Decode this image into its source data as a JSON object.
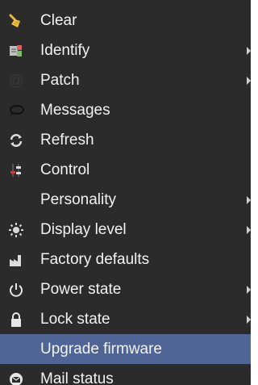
{
  "menu": {
    "items": [
      {
        "label": "Clear",
        "icon": "broom-icon",
        "has_submenu": false
      },
      {
        "label": "Identify",
        "icon": "identify-icon",
        "has_submenu": true
      },
      {
        "label": "Patch",
        "icon": "at-sign-icon",
        "has_submenu": true
      },
      {
        "label": "Messages",
        "icon": "speech-bubble-icon",
        "has_submenu": false
      },
      {
        "label": "Refresh",
        "icon": "refresh-icon",
        "has_submenu": false
      },
      {
        "label": "Control",
        "icon": "control-sliders-icon",
        "has_submenu": false
      },
      {
        "label": "Personality",
        "icon": "smiley-icon",
        "has_submenu": true
      },
      {
        "label": "Display level",
        "icon": "brightness-icon",
        "has_submenu": true
      },
      {
        "label": "Factory defaults",
        "icon": "factory-icon",
        "has_submenu": false
      },
      {
        "label": "Power state",
        "icon": "power-icon",
        "has_submenu": true
      },
      {
        "label": "Lock state",
        "icon": "lock-icon",
        "has_submenu": true
      },
      {
        "label": "Upgrade firmware",
        "icon": "",
        "has_submenu": false,
        "selected": true
      },
      {
        "label": "Mail status",
        "icon": "mail-icon",
        "has_submenu": false
      }
    ]
  },
  "colors": {
    "menu_background": "#2b2b2b",
    "menu_text": "#f2f2f2",
    "selected_background": "#4f6596"
  }
}
